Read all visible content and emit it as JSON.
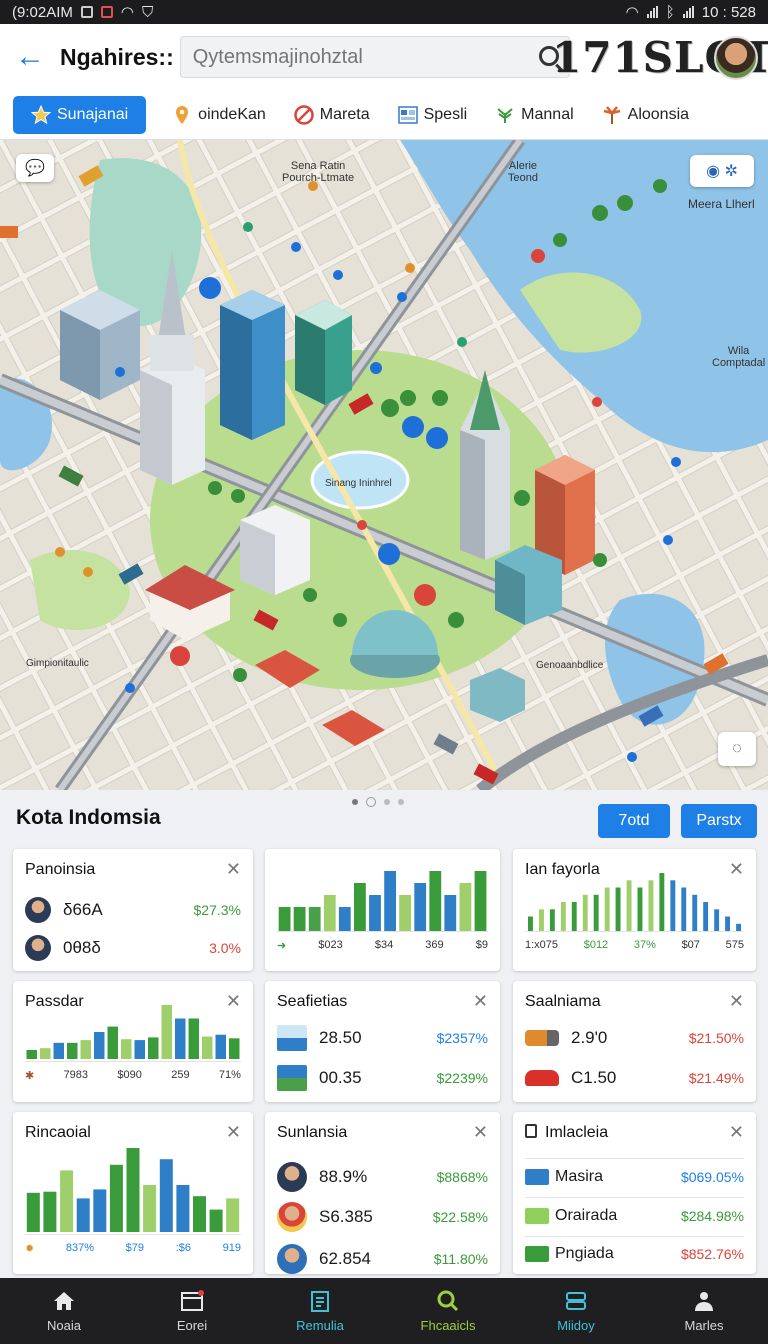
{
  "status": {
    "left_time": "(9:02AIM",
    "right_time": "10 : 528"
  },
  "appbar": {
    "title": "Ngahires::",
    "search_placeholder": "Qytemsmajinohztal",
    "brand": "171SLOT"
  },
  "categories": [
    {
      "label": "Sunajanai",
      "icon": "star-icon",
      "active": true
    },
    {
      "label": "oindeKan",
      "icon": "location-pin-icon"
    },
    {
      "label": "Mareta",
      "icon": "no-entry-icon"
    },
    {
      "label": "Spesli",
      "icon": "grid-icon"
    },
    {
      "label": "Mannal",
      "icon": "plant-icon"
    },
    {
      "label": "Aloonsia",
      "icon": "palm-icon"
    }
  ],
  "map": {
    "labels": {
      "top_center": "Sena Ratin\nPourch-Ltmate",
      "top_right_a": "Alerie\nTeond",
      "top_right_b": "Meera Llherl",
      "right_mid": "Wila\nComptadal",
      "plaza": "Sinang Ininhrel",
      "bottom_left": "Gimpionitaulic",
      "bottom_right": "Genoaanbdlice"
    }
  },
  "section": {
    "title": "Kota Indomsia",
    "btn1": "7otd",
    "btn2": "Parstx"
  },
  "cards": {
    "panoinsia": {
      "title": "Panoinsia",
      "rows": [
        {
          "value": "δ66A",
          "pct": "$27.3%"
        },
        {
          "value": "0θ8δ",
          "pct": "3.0%"
        }
      ]
    },
    "chart1": {
      "ticks": [
        "$023",
        "$34",
        "369",
        "$9"
      ]
    },
    "chart2": {
      "title": "Ian fayorla",
      "ticks": [
        "1:x075",
        "$012",
        "37%",
        "$07",
        "575"
      ]
    },
    "passdar": {
      "title": "Passdar",
      "ticks": [
        "7983",
        "$090",
        "259",
        "71%"
      ]
    },
    "seafietias": {
      "title": "Seafietias",
      "rows": [
        {
          "value": "28.50",
          "pct": "$2357%"
        },
        {
          "value": "00.35",
          "pct": "$2239%"
        }
      ]
    },
    "saalniama": {
      "title": "Saalniama",
      "rows": [
        {
          "value": "2.9'0",
          "pct": "$21.50%"
        },
        {
          "value": "C1.50",
          "pct": "$21.49%"
        }
      ]
    },
    "rincaoial": {
      "title": "Rincaoial",
      "ticks": [
        "837%",
        "$79",
        ":$6",
        "919"
      ]
    },
    "sunlansia": {
      "title": "Sunlansia",
      "rows": [
        {
          "value": "88.9%",
          "pct": "$8868%"
        },
        {
          "value": "S6.385",
          "pct": "$22.58%"
        },
        {
          "value": "62.854",
          "pct": "$11.80%"
        }
      ]
    },
    "imlacleia": {
      "title": "Imlacleia",
      "rows": [
        {
          "value": "Masira",
          "pct": "$069.05%"
        },
        {
          "value": "Orairada",
          "pct": "$284.98%"
        },
        {
          "value": "Pngiada",
          "pct": "$852.76%"
        }
      ]
    }
  },
  "chart_data": [
    {
      "type": "bar",
      "values": [
        2,
        2,
        2,
        3,
        2,
        4,
        3,
        5,
        3,
        4,
        5,
        3,
        4,
        5
      ],
      "categories": [
        "$023",
        "$34",
        "369",
        "$9"
      ]
    },
    {
      "type": "bar",
      "values": [
        2,
        3,
        3,
        4,
        4,
        5,
        5,
        6,
        6,
        7,
        6,
        7,
        8,
        7,
        6,
        5,
        4,
        3,
        2,
        1
      ],
      "categories": [
        "1:x075",
        "$012",
        "37%",
        "$07",
        "575"
      ]
    },
    {
      "type": "bar",
      "values": [
        1,
        1.2,
        1.8,
        1.8,
        2.1,
        3,
        3.6,
        2.2,
        2.1,
        2.4,
        6,
        4.5,
        4.5,
        2.5,
        2.7,
        2.3
      ],
      "categories": [
        "7983",
        "$090",
        "259",
        "71%"
      ]
    },
    {
      "type": "bar",
      "values": [
        3.5,
        3.6,
        5.5,
        3,
        3.8,
        6,
        7.5,
        4.2,
        6.5,
        4.2,
        3.2,
        2,
        3
      ],
      "categories": [
        "837%",
        "$79",
        ":$6",
        "919"
      ]
    }
  ],
  "bottom_nav": [
    {
      "label": "Noaia",
      "icon": "home-icon"
    },
    {
      "label": "Eorei",
      "icon": "calendar-icon"
    },
    {
      "label": "Remulia",
      "icon": "clipboard-icon"
    },
    {
      "label": "Fhcaaicls",
      "icon": "search-icon"
    },
    {
      "label": "Miidoy",
      "icon": "server-icon"
    },
    {
      "label": "Marles",
      "icon": "person-icon"
    }
  ]
}
